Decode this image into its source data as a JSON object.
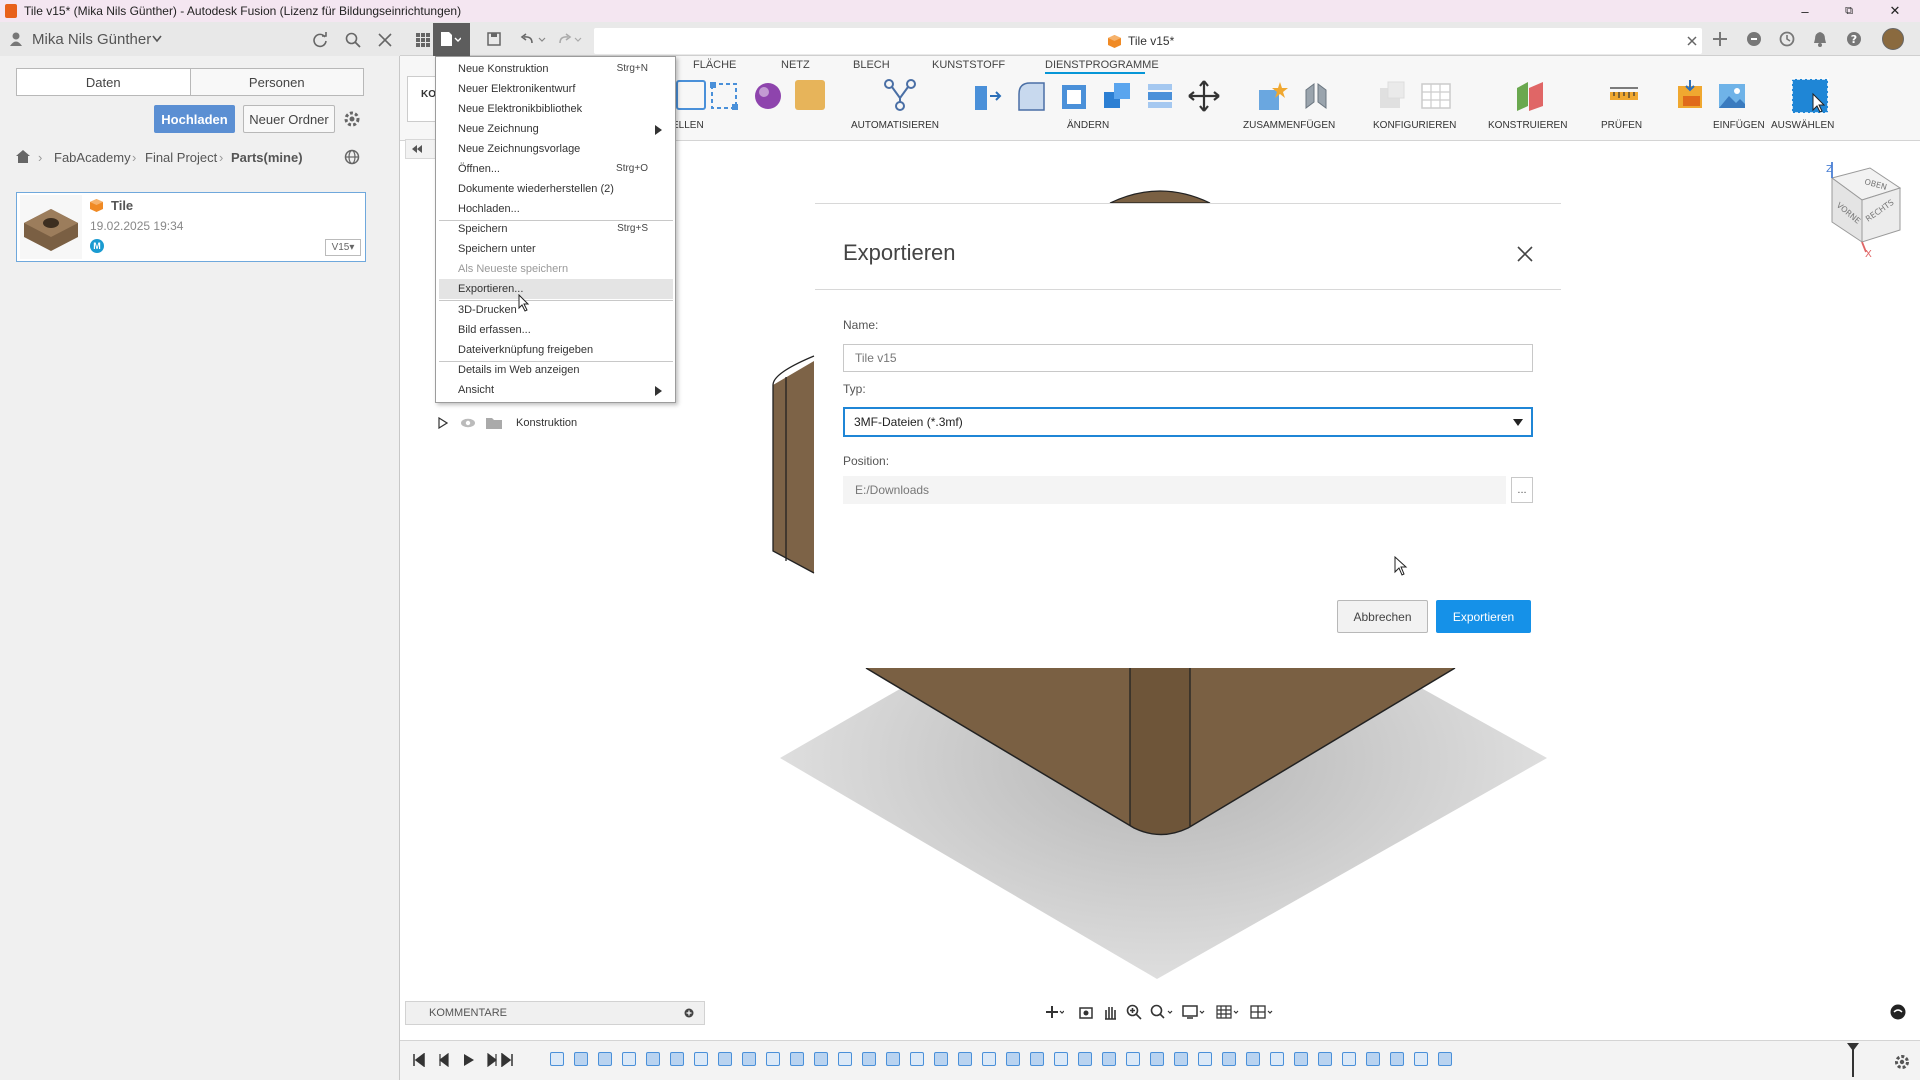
{
  "window": {
    "title": "Tile v15* (Mika Nils Günther) - Autodesk Fusion (Lizenz für Bildungseinrichtungen)",
    "minimize": "–",
    "maximize": "⧉",
    "close": "✕"
  },
  "user": {
    "name": "Mika Nils Günther"
  },
  "data_panel": {
    "tabs": [
      "Daten",
      "Personen"
    ],
    "upload_label": "Hochladen",
    "new_folder_label": "Neuer Ordner",
    "breadcrumb": [
      "FabAcademy",
      "Final Project",
      "Parts(mine)"
    ],
    "file": {
      "name": "Tile",
      "date": "19.02.2025 19:34",
      "version": "V15"
    }
  },
  "document_tab": {
    "title": "Tile v15*"
  },
  "ribbon": {
    "tabs": [
      "FLÄCHE",
      "NETZ",
      "BLECH",
      "KUNSTSTOFF",
      "DIENSTPROGRAMME"
    ],
    "groups": [
      "ELLEN",
      "AUTOMATISIEREN",
      "ÄNDERN",
      "ZUSAMMENFÜGEN",
      "KONFIGURIEREN",
      "KONSTRUIEREN",
      "PRÜFEN",
      "EINFÜGEN",
      "AUSWÄHLEN"
    ],
    "cut_label": "KO"
  },
  "file_menu": {
    "items": [
      {
        "label": "Neue Konstruktion",
        "shortcut": "Strg+N"
      },
      {
        "label": "Neuer Elektronikentwurf",
        "shortcut": ""
      },
      {
        "label": "Neue Elektronikbibliothek",
        "shortcut": ""
      },
      {
        "label": "Neue Zeichnung",
        "shortcut": ""
      },
      {
        "label": "Neue Zeichnungsvorlage",
        "shortcut": ""
      },
      {
        "label": "Öffnen...",
        "shortcut": "Strg+O"
      },
      {
        "label": "Dokumente wiederherstellen (2)",
        "shortcut": ""
      },
      {
        "label": "Hochladen...",
        "shortcut": ""
      },
      {
        "label": "Speichern",
        "shortcut": "Strg+S"
      },
      {
        "label": "Speichern unter",
        "shortcut": ""
      },
      {
        "label": "Als Neueste speichern",
        "shortcut": ""
      },
      {
        "label": "Exportieren...",
        "shortcut": ""
      },
      {
        "label": "3D-Drucken",
        "shortcut": ""
      },
      {
        "label": "Bild erfassen...",
        "shortcut": ""
      },
      {
        "label": "Dateiverknüpfung freigeben",
        "shortcut": ""
      },
      {
        "label": "Details im Web anzeigen",
        "shortcut": ""
      },
      {
        "label": "Ansicht",
        "shortcut": ""
      }
    ]
  },
  "browser": {
    "node_label": "Konstruktion"
  },
  "viewcube": {
    "top": "OBEN",
    "front": "VORNE",
    "right": "RECHTS",
    "z_axis": "Z",
    "x_axis": "X"
  },
  "export_dialog": {
    "title": "Exportieren",
    "name_label": "Name:",
    "name_value": "Tile v15",
    "type_label": "Typ:",
    "type_value": "3MF-Dateien (*.3mf)",
    "position_label": "Position:",
    "position_value": "E:/Downloads",
    "browse_label": "...",
    "cancel_label": "Abbrechen",
    "export_label": "Exportieren"
  },
  "comments": {
    "label": "KOMMENTARE"
  }
}
